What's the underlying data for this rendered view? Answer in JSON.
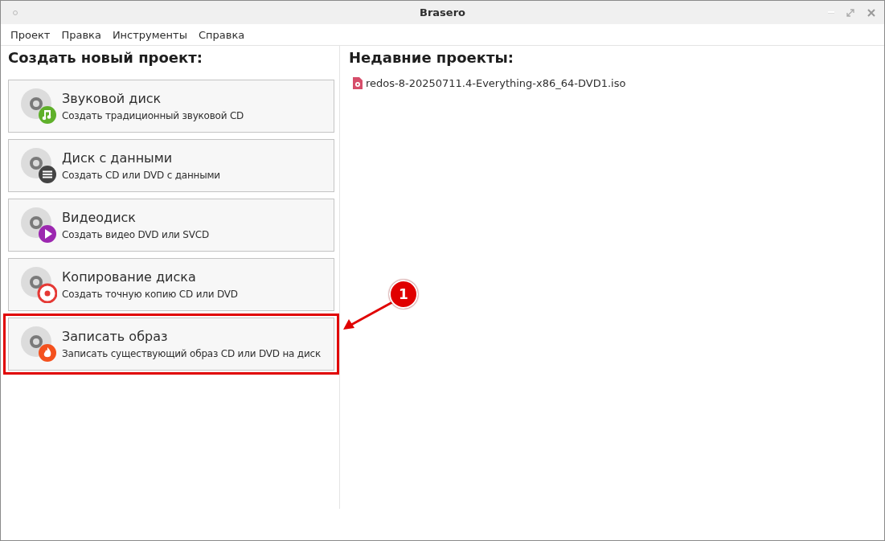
{
  "window": {
    "title": "Brasero"
  },
  "menu": [
    "Проект",
    "Правка",
    "Инструменты",
    "Справка"
  ],
  "new_project": {
    "heading": "Создать новый проект:",
    "items": [
      {
        "kind": "audio",
        "title": "Звуковой диск",
        "description": "Создать традиционный звуковой CD",
        "highlighted": false
      },
      {
        "kind": "data",
        "title": "Диск с данными",
        "description": "Создать CD или DVD с данными",
        "highlighted": false
      },
      {
        "kind": "video",
        "title": "Видеодиск",
        "description": "Создать видео DVD или SVCD",
        "highlighted": false
      },
      {
        "kind": "copy",
        "title": "Копирование диска",
        "description": "Создать точную копию CD или DVD",
        "highlighted": false
      },
      {
        "kind": "image",
        "title": "Записать образ",
        "description": "Записать существующий образ CD или DVD на диск",
        "highlighted": true
      }
    ]
  },
  "recent_projects": {
    "heading": "Недавние проекты:",
    "files": [
      "redos-8-20250711.4-Everything-x86_64-DVD1.iso"
    ]
  },
  "callout": {
    "number": "1"
  }
}
